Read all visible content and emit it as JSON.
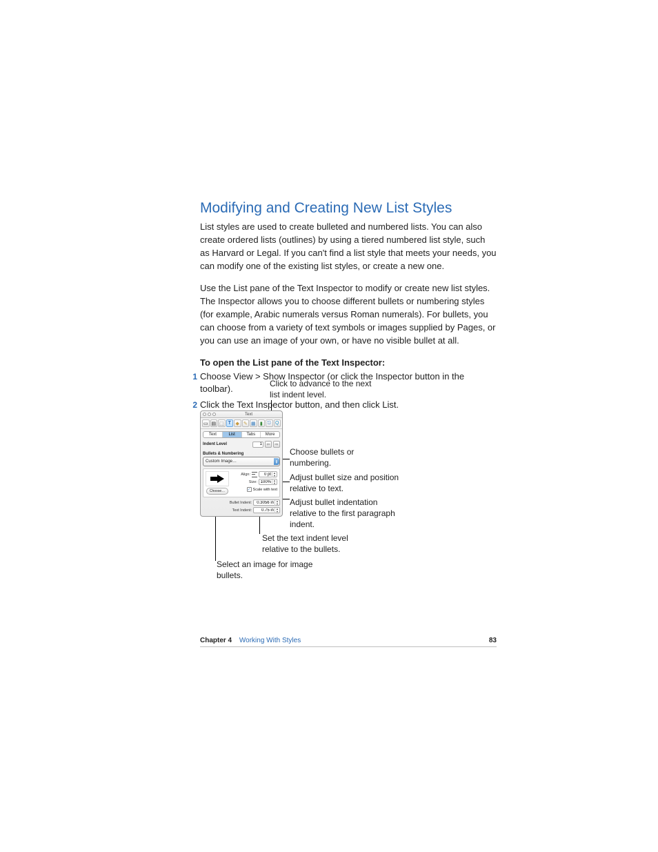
{
  "heading": "Modifying and Creating New List Styles",
  "para1": "List styles are used to create bulleted and numbered lists. You can also create ordered lists (outlines) by using a tiered numbered list style, such as Harvard or Legal. If you can't find a list style that meets your needs, you can modify one of the existing list styles, or create a new one.",
  "para2": "Use the List pane of the Text Inspector to modify or create new list styles. The Inspector allows you to choose different bullets or numbering styles (for example, Arabic numerals versus Roman numerals). For bullets, you can choose from a variety of text symbols or images supplied by Pages, or you can use an image of your own, or have no visible bullet at all.",
  "bold_intro": "To open the List pane of the Text Inspector:",
  "steps": [
    {
      "num": "1",
      "text": "Choose View > Show Inspector (or click the Inspector button in the toolbar)."
    },
    {
      "num": "2",
      "text": "Click the Text Inspector button, and then click List."
    }
  ],
  "callouts": {
    "indent_level": "Click to advance to the next list indent level.",
    "bullets_numbering": "Choose bullets or numbering.",
    "size": "Adjust bullet size and position relative to text.",
    "bullet_indent": "Adjust bullet indentation relative to the first paragraph indent.",
    "text_indent": "Set the text indent level relative to the bullets.",
    "choose_image": "Select an image for image bullets."
  },
  "inspector": {
    "title": "Text",
    "toolbar_icons": [
      "document",
      "layout",
      "wrap",
      "text",
      "graphic",
      "metrics",
      "table",
      "chart",
      "link",
      "quicktime"
    ],
    "tabs": [
      "Text",
      "List",
      "Tabs",
      "More"
    ],
    "active_tab": "List",
    "indent_level_label": "Indent Level",
    "indent_level_value": "1",
    "bullets_section": "Bullets & Numbering",
    "dropdown_value": "Custom Image…",
    "choose_label": "Choose…",
    "align_label": "Align:",
    "align_value": "0 pt",
    "size_label": "Size:",
    "size_value": "100%",
    "scale_label": "Scale with text",
    "bullet_indent_label": "Bullet Indent:",
    "bullet_indent_value": "0.3056 in",
    "text_indent_label": "Text Indent:",
    "text_indent_value": "0.75 in"
  },
  "footer": {
    "chapter": "Chapter 4",
    "title": "Working With Styles",
    "page": "83"
  }
}
